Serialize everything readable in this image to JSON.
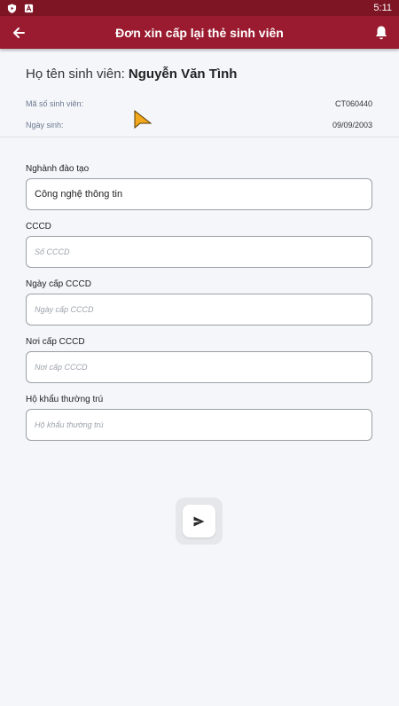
{
  "status_bar": {
    "time": "5:11"
  },
  "app_bar": {
    "title": "Đơn xin cấp lại thẻ sinh viên"
  },
  "student": {
    "name_label": "Họ tên sinh viên:",
    "name": "Nguyễn Văn Tình",
    "id_label": "Mã số sinh viên:",
    "id_value": "CT060440",
    "dob_label": "Ngày sinh:",
    "dob_value": "09/09/2003"
  },
  "form": {
    "major": {
      "label": "Nghành đào tạo",
      "value": "Công nghệ thông tin"
    },
    "cccd": {
      "label": "CCCD",
      "placeholder": "Số CCCD"
    },
    "cccd_date": {
      "label": "Ngày cấp CCCD",
      "placeholder": "Ngày cấp CCCD"
    },
    "cccd_place": {
      "label": "Nơi cấp CCCD",
      "placeholder": "Nơi cấp CCCD"
    },
    "residence": {
      "label": "Hộ khẩu thường trú",
      "placeholder": "Hộ khẩu thường trú"
    }
  },
  "colors": {
    "primary": "#9a1b2f",
    "status_bar": "#7e1524",
    "background": "#f5f6fa"
  },
  "icons": {
    "back": "arrow-left",
    "bell": "bell",
    "submit": "send"
  }
}
